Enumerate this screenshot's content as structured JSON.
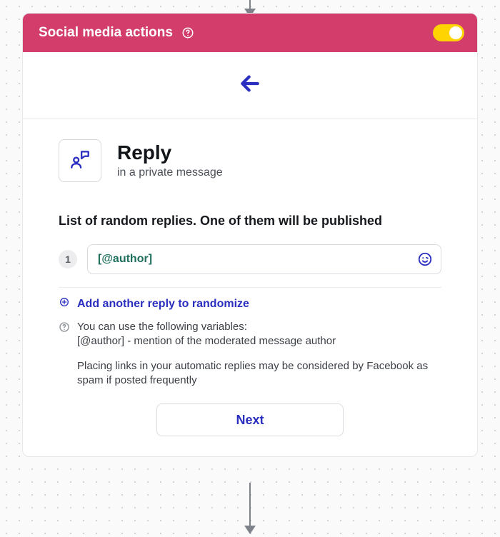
{
  "header": {
    "title": "Social media actions",
    "toggle_on": true
  },
  "reply": {
    "title": "Reply",
    "subtitle": "in a private message"
  },
  "list": {
    "label": "List of random replies. One of them will be published",
    "items": [
      {
        "index": "1",
        "value": "[@author]"
      }
    ]
  },
  "add_link": "Add another reply to randomize",
  "hint": {
    "line1": "You can use the following variables:",
    "line2": "[@author] - mention of the moderated message author",
    "warning": "Placing links in your automatic replies may be considered by Facebook as spam if posted frequently"
  },
  "next_label": "Next"
}
